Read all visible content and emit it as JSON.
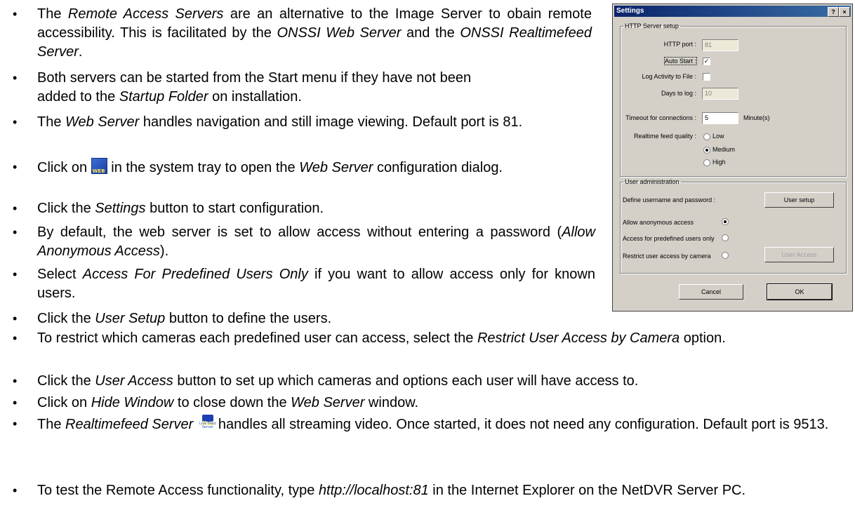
{
  "bullets": [
    {
      "parts": [
        [
          "The ",
          ""
        ],
        [
          "Remote Access Servers",
          "i"
        ],
        [
          " are an alternative to the Image Server to obain remote accessibility. This is facilitated by the ",
          ""
        ],
        [
          "ONSSI Web Server",
          "i"
        ],
        [
          " and the ",
          ""
        ],
        [
          "ONSSI Realtimefeed Server",
          "i"
        ],
        [
          ".",
          ""
        ]
      ]
    },
    {
      "parts": [
        [
          "Both servers can be started from the Start menu if they have not been added to the ",
          ""
        ],
        [
          "Startup Folder",
          "i"
        ],
        [
          " on installation.",
          ""
        ]
      ]
    },
    {
      "parts": [
        [
          "The ",
          ""
        ],
        [
          "Web Server",
          "i"
        ],
        [
          " handles navigation and still image viewing. Default port is 81.",
          ""
        ]
      ]
    },
    {
      "parts": [
        [
          "Click on ",
          ""
        ],
        [
          "web-server-tray-icon",
          "icon"
        ],
        [
          " in the system tray to open the ",
          ""
        ],
        [
          "Web Server",
          "i"
        ],
        [
          " configuration dialog.",
          ""
        ]
      ]
    },
    {
      "parts": [
        [
          "Click the ",
          ""
        ],
        [
          "Settings",
          "i"
        ],
        [
          " button to start configuration.",
          ""
        ]
      ]
    },
    {
      "parts": [
        [
          "By default, the web server is set to allow access without entering a password (",
          ""
        ],
        [
          "Allow Anonymous Access",
          "i"
        ],
        [
          ").",
          ""
        ]
      ]
    },
    {
      "parts": [
        [
          "Select ",
          ""
        ],
        [
          "Access For Predefined Users Only",
          "i"
        ],
        [
          " if you want to allow access only for known users.",
          ""
        ]
      ]
    },
    {
      "parts": [
        [
          "Click the ",
          ""
        ],
        [
          "User Setup",
          "i"
        ],
        [
          " button to define the users.",
          ""
        ]
      ]
    },
    {
      "parts": [
        [
          "To restrict which cameras each predefined user can access, select the ",
          ""
        ],
        [
          "Restrict User Access by Camera",
          "i"
        ],
        [
          " option.",
          ""
        ]
      ]
    },
    {
      "parts": [
        [
          "Click the ",
          ""
        ],
        [
          "User Access",
          "i"
        ],
        [
          " button to set up which cameras and options each user will have access to.",
          ""
        ]
      ]
    },
    {
      "parts": [
        [
          "Click on ",
          ""
        ],
        [
          "Hide Window",
          "i"
        ],
        [
          " to close down the ",
          ""
        ],
        [
          "Web Server",
          "i"
        ],
        [
          " window.",
          ""
        ]
      ]
    },
    {
      "parts": [
        [
          "The ",
          ""
        ],
        [
          "Realtimefeed Server",
          "i"
        ],
        [
          " ",
          ""
        ],
        [
          "live-feed-server-icon",
          "icon"
        ],
        [
          "handles all streaming video. Once started, it does not need any configuration. Default port is 9513.",
          ""
        ]
      ]
    },
    {
      "parts": [
        [
          "To test the Remote Access functionality, type ",
          ""
        ],
        [
          "http://localhost:81",
          "i"
        ],
        [
          " in the Internet Explorer on the NetDVR Server PC.",
          ""
        ]
      ]
    }
  ],
  "icon_text": {
    "live_caption": "Live Feed Server"
  },
  "dialog": {
    "title": "Settings",
    "help_button": "?",
    "close_button": "×",
    "http_group": "HTTP Server setup",
    "http_port_label": "HTTP port :",
    "http_port_value": "81",
    "auto_start_label": "Auto Start :",
    "auto_start_checked": true,
    "log_activity_label": "Log Activity to File :",
    "log_activity_checked": false,
    "days_to_log_label": "Days to log :",
    "days_to_log_value": "10",
    "timeout_label": "Timeout for connections :",
    "timeout_value": "5",
    "timeout_unit": "Minute(s)",
    "quality_label": "Realtime feed quality :",
    "quality_options": [
      "Low",
      "Medium",
      "High"
    ],
    "quality_selected": "Medium",
    "user_group": "User administration",
    "define_label": "Define username and password :",
    "user_setup_button": "User setup",
    "access_options": [
      "Allow anonymous access",
      "Access for predefined users only",
      "Restrict user access by camera"
    ],
    "access_selected": "Allow anonymous access",
    "user_access_button": "User Access",
    "cancel_button": "Cancel",
    "ok_button": "OK"
  }
}
